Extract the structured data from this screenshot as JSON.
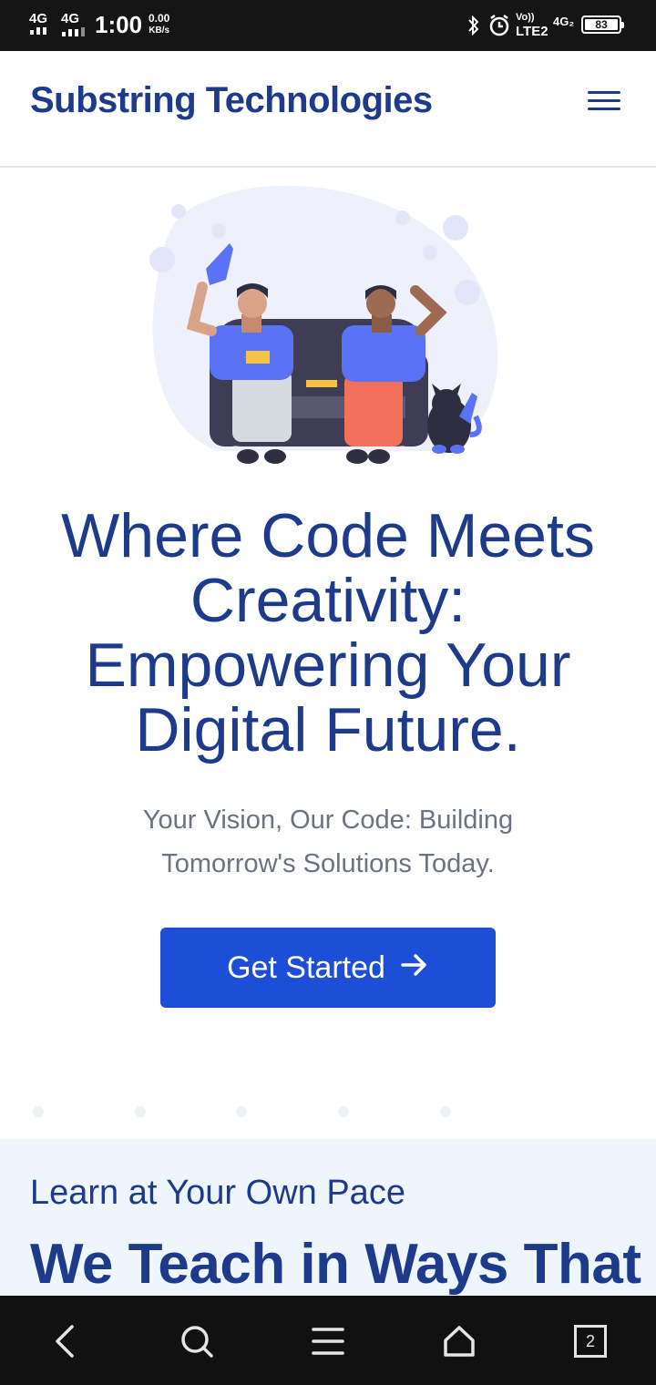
{
  "status_bar": {
    "sim1": "4G",
    "sim2": "4G",
    "time": "1:00",
    "speed_value": "0.00",
    "speed_unit": "KB/s",
    "volte_top": "Vo))",
    "volte_bottom": "LTE2",
    "network": "4G₂",
    "battery": "83"
  },
  "header": {
    "brand": "Substring Technologies",
    "menu_icon": "hamburger-menu-icon"
  },
  "hero": {
    "illustration": "people-watching-game-on-couch-illustration",
    "title": "Where Code Meets Creativity: Empowering Your Digital Future.",
    "subtitle": "Your Vision, Our Code: Building Tomorrow's Solutions Today.",
    "cta_label": "Get Started",
    "cta_icon": "arrow-right-icon"
  },
  "section2": {
    "eyebrow": "Learn at Your Own Pace",
    "title": "We Teach in Ways That"
  },
  "nav_bar": {
    "tabs_count": "2"
  },
  "colors": {
    "brand": "#1e3a8a",
    "accent": "#1d4ed8",
    "section_bg": "#eff5fd"
  }
}
